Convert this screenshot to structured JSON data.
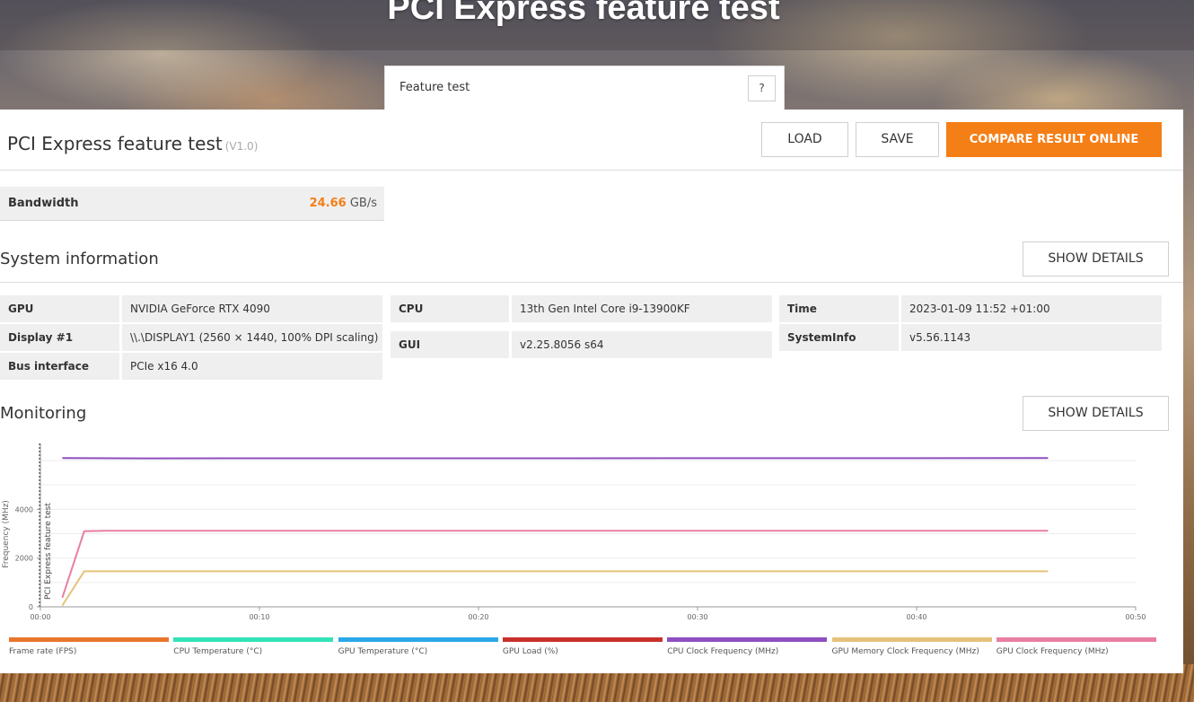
{
  "page": {
    "heading": "PCI Express feature test",
    "tab_label": "Feature test",
    "help_label": "?"
  },
  "result": {
    "title": "PCI Express feature test",
    "version": "(V1.0)",
    "buttons": {
      "load": "LOAD",
      "save": "SAVE",
      "compare": "COMPARE RESULT ONLINE"
    },
    "bandwidth": {
      "label": "Bandwidth",
      "value": "24.66",
      "unit": "GB/s"
    }
  },
  "system_info": {
    "title": "System information",
    "details_label": "SHOW DETAILS",
    "gpu": {
      "label": "GPU",
      "value": "NVIDIA GeForce RTX 4090"
    },
    "display": {
      "label": "Display #1",
      "value": "\\\\.\\DISPLAY1 (2560 × 1440, 100% DPI scaling)"
    },
    "bus": {
      "label": "Bus interface",
      "value": "PCIe x16 4.0"
    },
    "cpu": {
      "label": "CPU",
      "value": "13th Gen Intel Core i9-13900KF"
    },
    "gui": {
      "label": "GUI",
      "value": "v2.25.8056 s64"
    },
    "time": {
      "label": "Time",
      "value": "2023-01-09 11:52 +01:00"
    },
    "sysinfo": {
      "label": "SystemInfo",
      "value": "v5.56.1143"
    }
  },
  "monitoring": {
    "title": "Monitoring",
    "details_label": "SHOW DETAILS"
  },
  "chart_data": {
    "type": "line",
    "ylabel": "Frequency (MHz)",
    "marker_label": "PCI Express feature test",
    "x_ticks": [
      "00:00",
      "00:10",
      "00:20",
      "00:30",
      "00:40",
      "00:50"
    ],
    "y_ticks": [
      0,
      2000,
      4000
    ],
    "xlim": [
      0,
      50
    ],
    "ylim": [
      0,
      6700
    ],
    "grid": true,
    "legend_position": "bottom",
    "legend": [
      {
        "name": "Frame rate (FPS)",
        "color": "#e8762b"
      },
      {
        "name": "CPU Temperature (°C)",
        "color": "#33e3b8"
      },
      {
        "name": "GPU Temperature (°C)",
        "color": "#2aa8e8"
      },
      {
        "name": "GPU Load (%)",
        "color": "#c8302c"
      },
      {
        "name": "CPU Clock Frequency (MHz)",
        "color": "#8e4fc0"
      },
      {
        "name": "GPU Memory Clock Frequency (MHz)",
        "color": "#e5c27a"
      },
      {
        "name": "GPU Clock Frequency (MHz)",
        "color": "#e87ea3"
      }
    ],
    "series": [
      {
        "name": "CPU Clock Frequency (MHz)",
        "color": "#8e4fc0",
        "x": [
          1,
          5,
          46
        ],
        "y": [
          6100,
          6090,
          6100
        ]
      },
      {
        "name": "GPU Clock Frequency (MHz)",
        "color": "#e87ea3",
        "x": [
          1,
          2,
          3,
          46
        ],
        "y": [
          375,
          3100,
          3120,
          3120
        ]
      },
      {
        "name": "GPU Memory Clock Frequency (MHz)",
        "color": "#e5c27a",
        "x": [
          1,
          2,
          46
        ],
        "y": [
          50,
          1460,
          1460
        ]
      }
    ]
  }
}
